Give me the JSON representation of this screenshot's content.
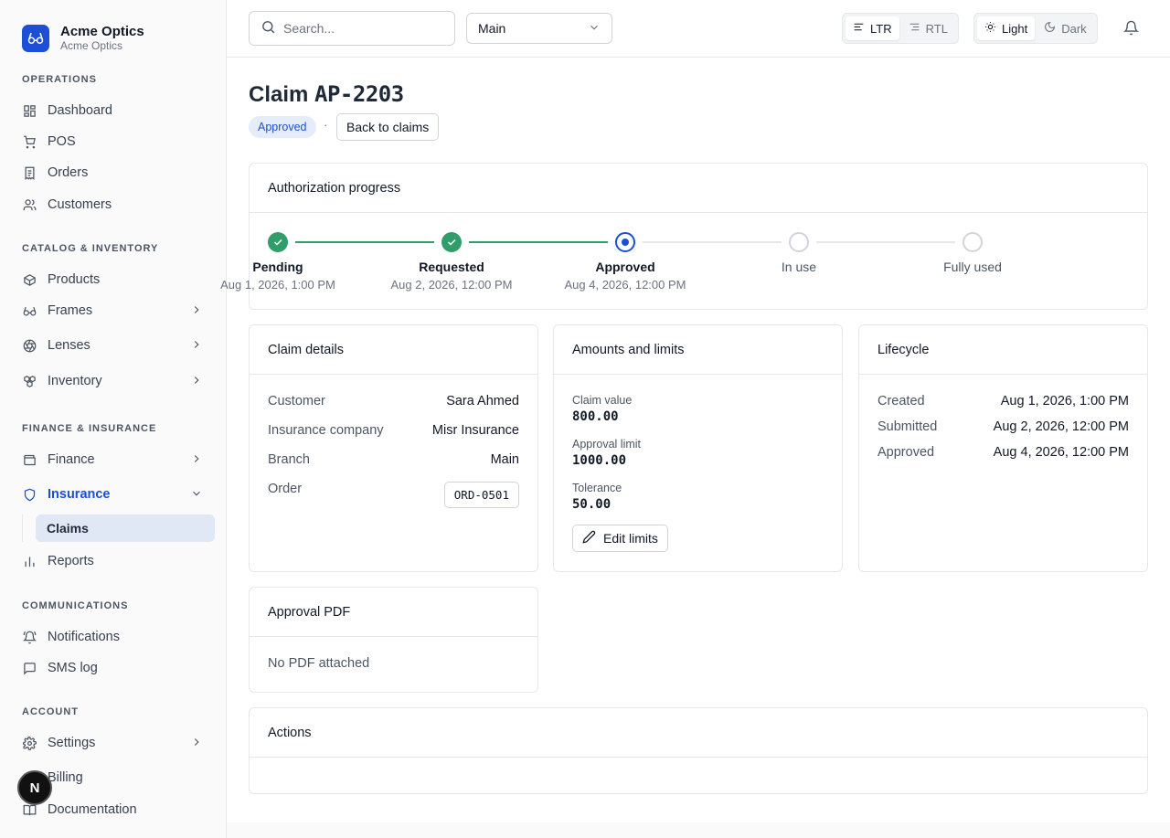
{
  "brand": {
    "name": "Acme Optics",
    "subtitle": "Acme Optics"
  },
  "sidebar": {
    "sections": [
      "OPERATIONS",
      "CATALOG & INVENTORY",
      "FINANCE & INSURANCE",
      "COMMUNICATIONS",
      "ACCOUNT"
    ],
    "items": [
      {
        "label": "Dashboard",
        "icon": "dashboard-icon"
      },
      {
        "label": "POS",
        "icon": "cart-icon"
      },
      {
        "label": "Orders",
        "icon": "receipt-icon"
      },
      {
        "label": "Customers",
        "icon": "users-icon"
      },
      {
        "label": "Products",
        "icon": "box-icon"
      },
      {
        "label": "Frames",
        "icon": "glasses-icon"
      },
      {
        "label": "Lenses",
        "icon": "aperture-icon"
      },
      {
        "label": "Inventory",
        "icon": "boxes-icon"
      },
      {
        "label": "Finance",
        "icon": "wallet-icon"
      },
      {
        "label": "Insurance",
        "icon": "shield-icon"
      },
      {
        "label": "Reports",
        "icon": "bar-chart-icon"
      },
      {
        "label": "Notifications",
        "icon": "bell-ring-icon"
      },
      {
        "label": "SMS log",
        "icon": "message-icon"
      },
      {
        "label": "Settings",
        "icon": "gear-icon"
      },
      {
        "label": "Billing",
        "icon": "card-icon"
      },
      {
        "label": "Documentation",
        "icon": "book-icon"
      }
    ],
    "sub_item": "Claims",
    "badge_letter": "N"
  },
  "topbar": {
    "search_placeholder": "Search...",
    "branch_select": "Main",
    "dir_ltr": "LTR",
    "dir_rtl": "RTL",
    "theme_light": "Light",
    "theme_dark": "Dark"
  },
  "page": {
    "title_prefix": "Claim ",
    "title_code": "AP-2203",
    "status": "Approved",
    "separator": "·",
    "back_label": "Back to claims"
  },
  "progress": {
    "title": "Authorization progress",
    "steps": [
      {
        "label": "Pending",
        "date": "Aug 1, 2026, 1:00 PM",
        "state": "done"
      },
      {
        "label": "Requested",
        "date": "Aug 2, 2026, 12:00 PM",
        "state": "done"
      },
      {
        "label": "Approved",
        "date": "Aug 4, 2026, 12:00 PM",
        "state": "current"
      },
      {
        "label": "In use",
        "date": "",
        "state": "todo"
      },
      {
        "label": "Fully used",
        "date": "",
        "state": "todo"
      }
    ],
    "colors": {
      "done": "#2f9e6b",
      "current": "#1d4ed8",
      "todo": "#d1d5db"
    }
  },
  "claim_details": {
    "title": "Claim details",
    "rows": [
      {
        "key": "Customer",
        "value": "Sara Ahmed"
      },
      {
        "key": "Insurance company",
        "value": "Misr Insurance"
      },
      {
        "key": "Branch",
        "value": "Main"
      },
      {
        "key": "Order",
        "value": "ORD-0501"
      }
    ]
  },
  "amounts": {
    "title": "Amounts and limits",
    "items": [
      {
        "label": "Claim value",
        "value": "800.00"
      },
      {
        "label": "Approval limit",
        "value": "1000.00"
      },
      {
        "label": "Tolerance",
        "value": "50.00"
      }
    ],
    "edit_label": "Edit limits"
  },
  "lifecycle": {
    "title": "Lifecycle",
    "rows": [
      {
        "key": "Created",
        "value": "Aug 1, 2026, 1:00 PM"
      },
      {
        "key": "Submitted",
        "value": "Aug 2, 2026, 12:00 PM"
      },
      {
        "key": "Approved",
        "value": "Aug 4, 2026, 12:00 PM"
      }
    ]
  },
  "approval_pdf": {
    "title": "Approval PDF",
    "empty": "No PDF attached"
  },
  "actions": {
    "title": "Actions"
  }
}
